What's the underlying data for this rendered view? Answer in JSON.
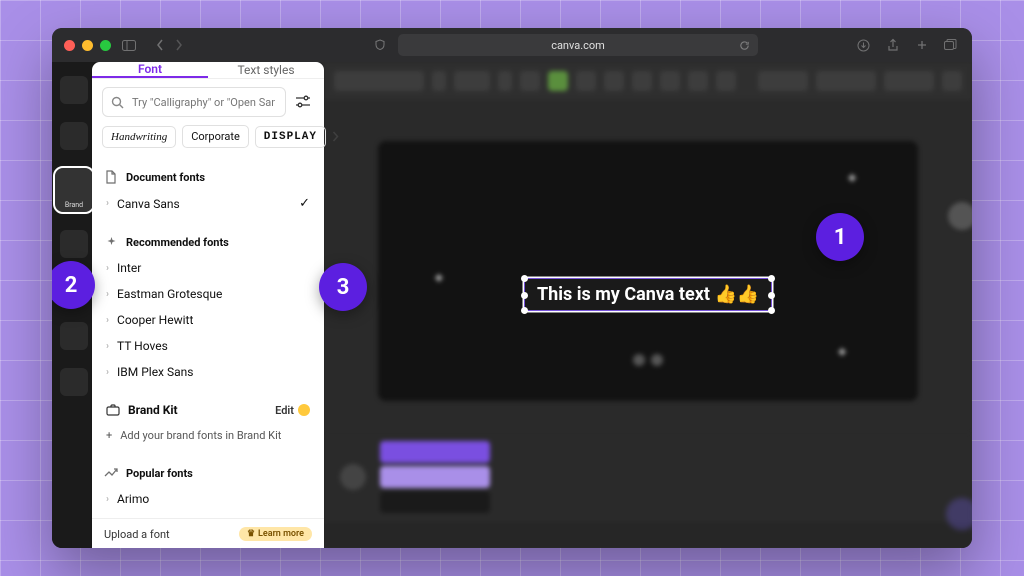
{
  "url": "canva.com",
  "sidebar": {
    "brand_label": "Brand"
  },
  "panel": {
    "tabs": {
      "font": "Font",
      "styles": "Text styles"
    },
    "search_placeholder": "Try \"Calligraphy\" or \"Open Sans\"",
    "chips": {
      "handwriting": "Handwriting",
      "corporate": "Corporate",
      "display": "DISPLAY"
    },
    "doc_fonts_header": "Document fonts",
    "doc_fonts": [
      {
        "name": "Canva Sans",
        "selected": true
      }
    ],
    "rec_header": "Recommended fonts",
    "rec_fonts": [
      {
        "name": "Inter"
      },
      {
        "name": "Eastman Grotesque"
      },
      {
        "name": "Cooper Hewitt"
      },
      {
        "name": "TT Hoves"
      },
      {
        "name": "IBM Plex Sans"
      }
    ],
    "brandkit": {
      "title": "Brand Kit",
      "edit": "Edit",
      "add": "Add your brand fonts in Brand Kit"
    },
    "popular_header": "Popular fonts",
    "popular_fonts": [
      {
        "name": "Arimo"
      }
    ],
    "footer": {
      "upload": "Upload a font",
      "learn": "Learn more"
    }
  },
  "canvas": {
    "text": "This is my Canva text 👍👍"
  },
  "callouts": {
    "c1": "1",
    "c2": "2",
    "c3": "3"
  }
}
